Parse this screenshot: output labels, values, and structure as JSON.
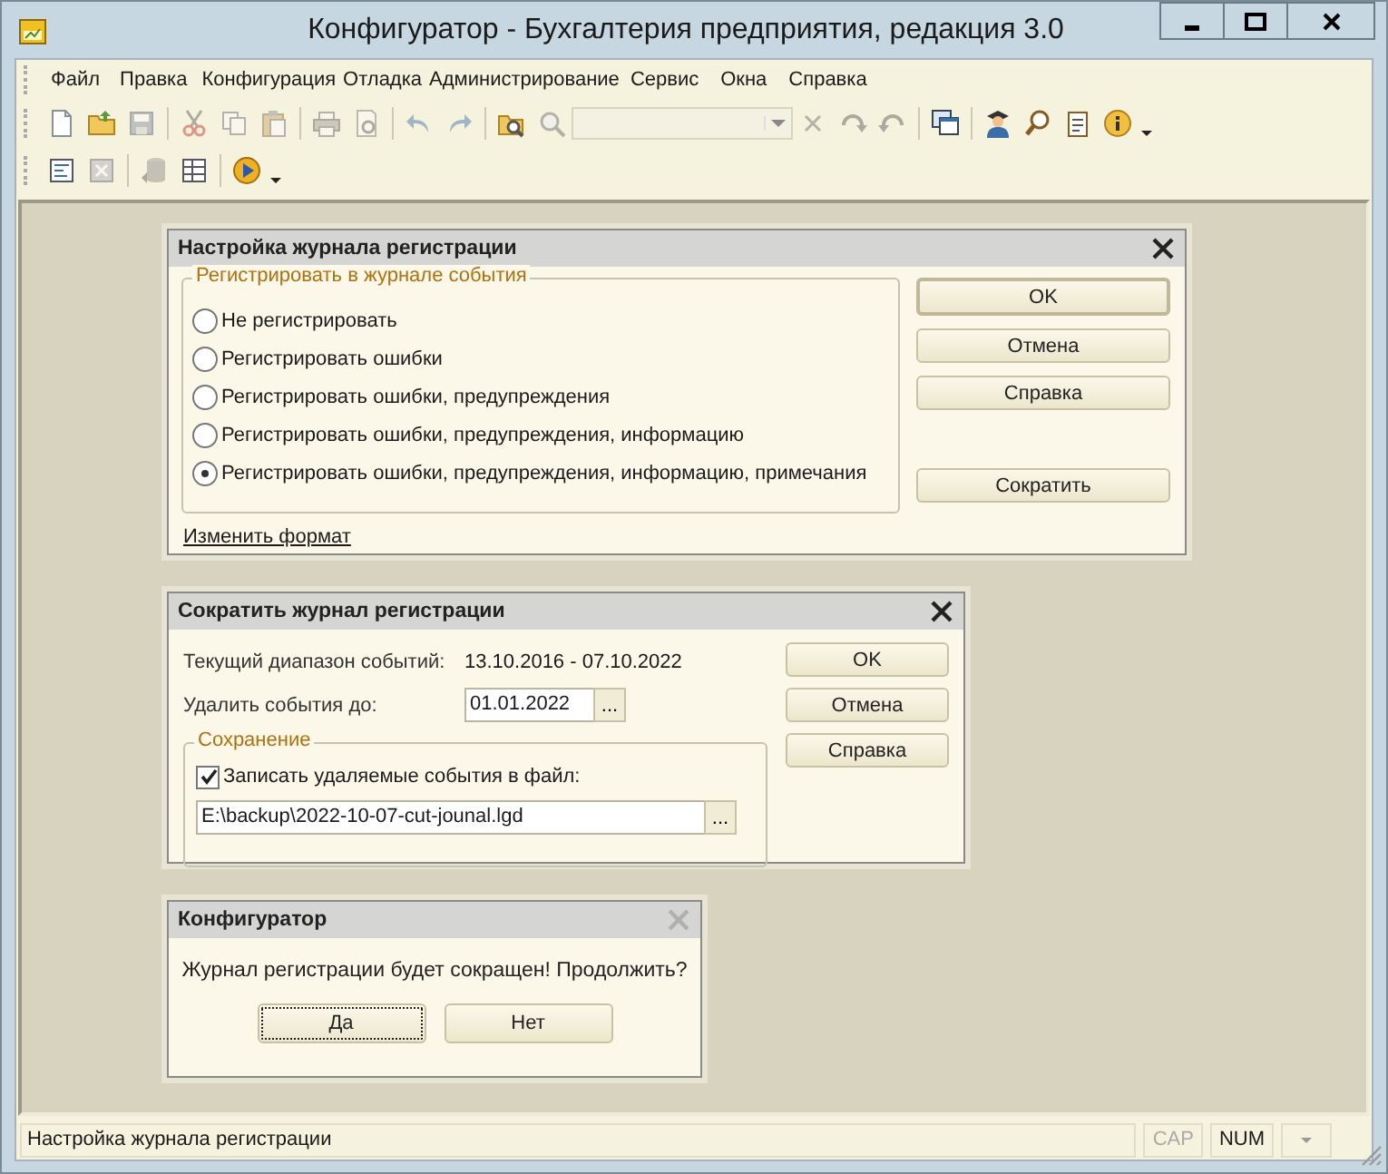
{
  "window": {
    "title": "Конфигуратор - Бухгалтерия предприятия, редакция 3.0"
  },
  "menu": [
    "Файл",
    "Правка",
    "Конфигурация",
    "Отладка",
    "Администрирование",
    "Сервис",
    "Окна",
    "Справка"
  ],
  "toolbars": [
    [
      {
        "kind": "icon",
        "disabled": false
      },
      {
        "kind": "icon",
        "disabled": false
      },
      {
        "kind": "icon",
        "disabled": true
      },
      {
        "kind": "separator"
      },
      {
        "kind": "icon",
        "disabled": true
      },
      {
        "kind": "icon",
        "disabled": true
      },
      {
        "kind": "icon",
        "disabled": true
      },
      {
        "kind": "separator"
      },
      {
        "kind": "icon",
        "disabled": true
      },
      {
        "kind": "icon",
        "disabled": true
      },
      {
        "kind": "separator"
      },
      {
        "kind": "icon",
        "disabled": true
      },
      {
        "kind": "icon",
        "disabled": true
      },
      {
        "kind": "separator"
      },
      {
        "kind": "icon",
        "disabled": false
      },
      {
        "kind": "icon",
        "disabled": true
      },
      {
        "kind": "combo",
        "disabled": true
      },
      {
        "kind": "icon",
        "disabled": true
      },
      {
        "kind": "icon",
        "disabled": true
      },
      {
        "kind": "icon",
        "disabled": true
      },
      {
        "kind": "separator"
      },
      {
        "kind": "icon",
        "disabled": false
      },
      {
        "kind": "separator"
      },
      {
        "kind": "icon",
        "disabled": false
      },
      {
        "kind": "icon",
        "disabled": false
      },
      {
        "kind": "icon",
        "disabled": false
      },
      {
        "kind": "icon",
        "disabled": false
      },
      {
        "kind": "dropdown"
      }
    ],
    [
      {
        "kind": "icon",
        "disabled": false
      },
      {
        "kind": "icon",
        "disabled": true
      },
      {
        "kind": "separator"
      },
      {
        "kind": "icon",
        "disabled": true
      },
      {
        "kind": "icon",
        "disabled": false
      },
      {
        "kind": "separator"
      },
      {
        "kind": "icon",
        "disabled": false
      },
      {
        "kind": "dropdown"
      }
    ]
  ],
  "settings_dialog": {
    "title": "Настройка журнала регистрации",
    "legend": "Регистрировать в журнале события",
    "options": [
      {
        "label": "Не регистрировать",
        "selected": false
      },
      {
        "label": "Регистрировать ошибки",
        "selected": false
      },
      {
        "label": "Регистрировать ошибки, предупреждения",
        "selected": false
      },
      {
        "label": "Регистрировать ошибки, предупреждения, информацию",
        "selected": false
      },
      {
        "label": "Регистрировать ошибки, предупреждения, информацию, примечания",
        "selected": true
      }
    ],
    "link": "Изменить формат",
    "buttons": [
      {
        "label": "OK",
        "default": true
      },
      {
        "label": "Отмена",
        "default": false
      },
      {
        "label": "Справка",
        "default": false
      },
      {
        "label": "Сократить",
        "default": false
      }
    ]
  },
  "shrink_dialog": {
    "title": "Сократить журнал регистрации",
    "range_label": "Текущий диапазон событий:",
    "range_value": "13.10.2016 - 07.10.2022",
    "delete_label": "Удалить события до:",
    "delete_value": "01.01.2022",
    "delete_button": "...",
    "legend": "Сохранение",
    "checkbox": {
      "label": "Записать удаляемые события в файл:",
      "checked": true
    },
    "file_value": "E:\\backup\\2022-10-07-cut-jounal.lgd",
    "file_button": "...",
    "buttons": [
      {
        "label": "OK",
        "default": false
      },
      {
        "label": "Отмена",
        "default": false
      },
      {
        "label": "Справка",
        "default": false
      }
    ]
  },
  "confirm_dialog": {
    "title": "Конфигуратор",
    "close_disabled": true,
    "message": "Журнал регистрации будет сокращен! Продолжить?",
    "buttons": [
      {
        "label": "Да",
        "focused": true
      },
      {
        "label": "Нет",
        "focused": false
      }
    ]
  },
  "status_bar": {
    "text": "Настройка журнала регистрации",
    "indicators": [
      {
        "label": "CAP",
        "on": false
      },
      {
        "label": "NUM",
        "on": true
      }
    ]
  }
}
